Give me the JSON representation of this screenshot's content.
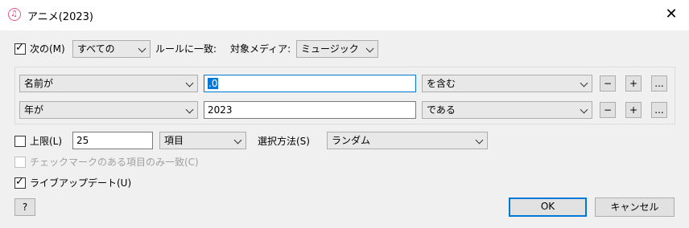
{
  "window": {
    "title": "アニメ(2023)",
    "close_icon": "close-icon",
    "app_icon": "itunes-icon"
  },
  "match": {
    "checked": true,
    "label": "次の(M)",
    "mode": "すべての",
    "rules_text": "ルールに一致:",
    "media_label": "対象メディア:",
    "media": "ミュージック"
  },
  "rules": [
    {
      "field": "名前が",
      "value": ".0",
      "operator": "を含む",
      "remove": "−",
      "add": "+",
      "more": "..."
    },
    {
      "field": "年が",
      "value": "2023",
      "operator": "である",
      "remove": "−",
      "add": "+",
      "more": "..."
    }
  ],
  "limit": {
    "checked": false,
    "label": "上限(L)",
    "value": "25",
    "unit": "項目",
    "method_label": "選択方法(S)",
    "method": "ランダム"
  },
  "checked_only": {
    "checked": false,
    "label": "チェックマークのある項目のみ一致(C)"
  },
  "live_update": {
    "checked": true,
    "label": "ライブアップデート(U)"
  },
  "buttons": {
    "help": "?",
    "ok": "OK",
    "cancel": "キャンセル"
  }
}
